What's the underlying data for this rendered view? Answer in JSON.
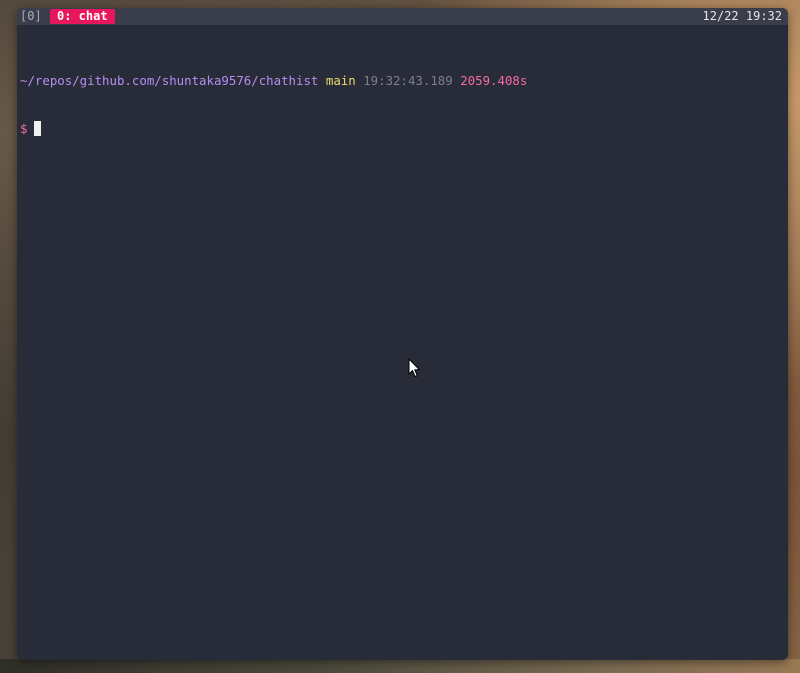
{
  "statusbar": {
    "session": "[0]",
    "window_tab": "0: chat",
    "clock": "12/22 19:32"
  },
  "terminal": {
    "path": "~/repos/github.com/shuntaka9576/chathist",
    "branch": "main",
    "time": "19:32:43.189",
    "duration": "2059.408s",
    "prompt_symbol": "$"
  },
  "colors": {
    "tab_active": "#e8175d",
    "path": "#b48ef0",
    "branch": "#ecd96a",
    "duration": "#f26ba6",
    "terminal_bg": "#282b38"
  },
  "icons": {
    "pointer": "mouse-pointer-icon"
  }
}
